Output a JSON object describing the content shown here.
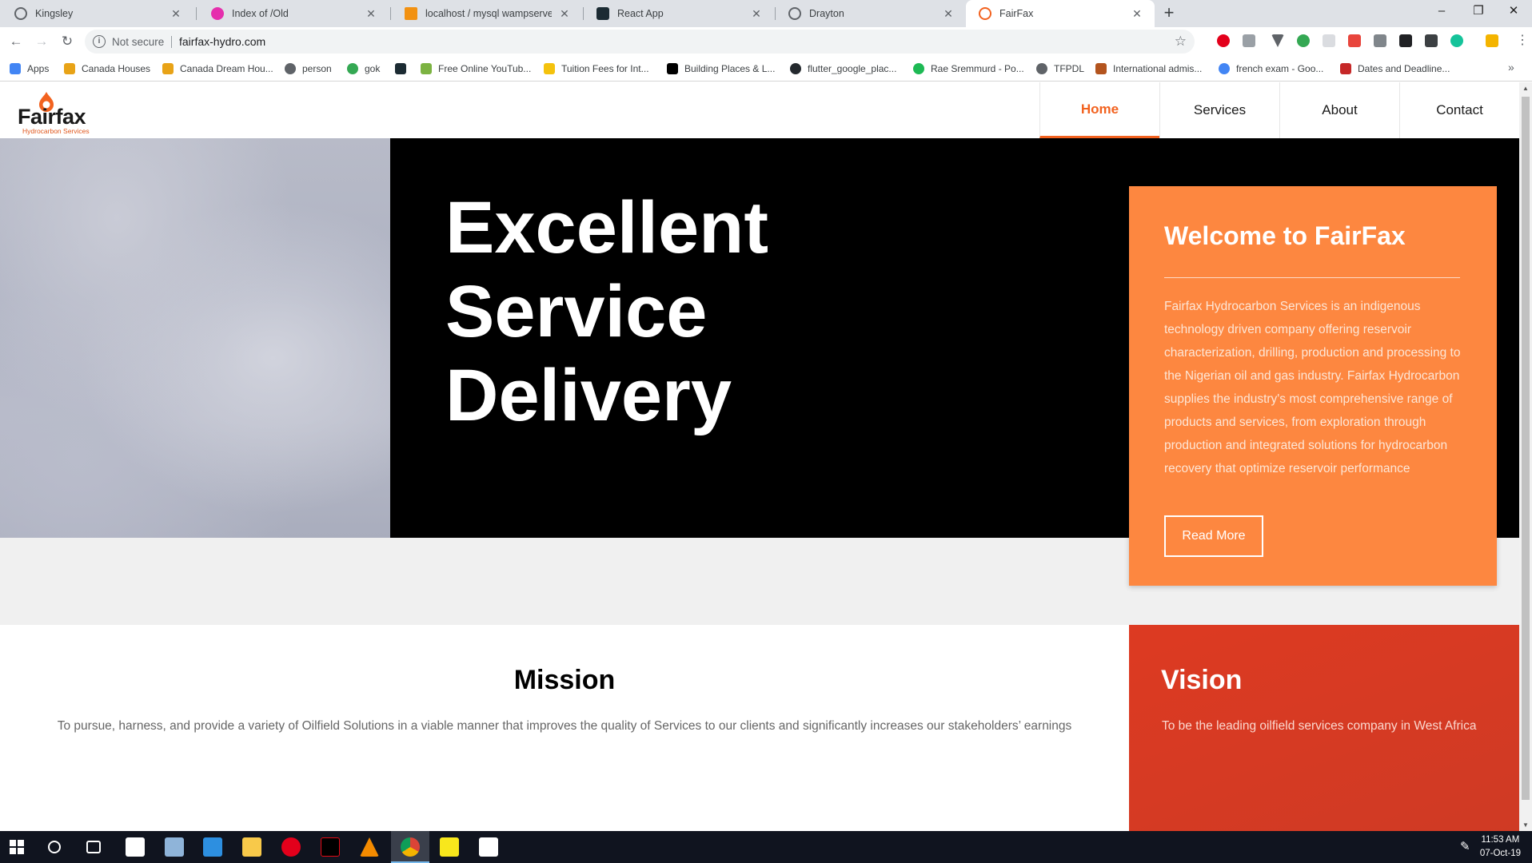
{
  "browser": {
    "tabs": [
      {
        "label": "Kingsley",
        "icon": "globe-icon",
        "color": "#5f6368"
      },
      {
        "label": "Index of /Old",
        "icon": "wamp-icon",
        "color": "#e52fad"
      },
      {
        "label": "localhost / mysql wampserver / s",
        "icon": "phpmyadmin-icon",
        "color": "#f29111"
      },
      {
        "label": "React App",
        "icon": "react-icon",
        "color": "#1c2b33"
      },
      {
        "label": "Drayton",
        "icon": "globe-icon",
        "color": "#5f6368"
      },
      {
        "label": "FairFax",
        "icon": "fairfax-icon",
        "color": "#f2621f"
      }
    ],
    "new_tab": "+",
    "window_controls": {
      "minimize": "–",
      "restore": "❐",
      "close": "✕"
    },
    "address": {
      "security": "Not secure",
      "url": "fairfax-hydro.com"
    },
    "bookmarks": [
      {
        "label": "Apps",
        "color": "#4285f4"
      },
      {
        "label": "Canada Houses",
        "color": "#e8a317"
      },
      {
        "label": "Canada Dream Hou...",
        "color": "#e8a317"
      },
      {
        "label": "person",
        "color": "#5f6368"
      },
      {
        "label": "gok",
        "color": "#34a853"
      },
      {
        "label": "",
        "color": "#1c2b33"
      },
      {
        "label": "Free Online YouTub...",
        "color": "#7cb342"
      },
      {
        "label": "Tuition Fees for Int...",
        "color": "#f4c20d"
      },
      {
        "label": "Building Places & L...",
        "color": "#000000"
      },
      {
        "label": "flutter_google_plac...",
        "color": "#24292e"
      },
      {
        "label": "Rae Sremmurd - Po...",
        "color": "#1db954"
      },
      {
        "label": "TFPDL",
        "color": "#5f6368"
      },
      {
        "label": "International admis...",
        "color": "#b3541e"
      },
      {
        "label": "french exam - Goo...",
        "color": "#4285f4"
      },
      {
        "label": "Dates and Deadline...",
        "color": "#c62828"
      }
    ]
  },
  "site": {
    "logo": {
      "name": "Fairfax",
      "tagline": "Hydrocarbon Services"
    },
    "nav": [
      "Home",
      "Services",
      "About",
      "Contact"
    ],
    "hero": {
      "line1": "Excellent",
      "line2": "Service",
      "line3": "Delivery"
    },
    "welcome": {
      "title": "Welcome to FairFax",
      "body": "Fairfax Hydrocarbon Services is an indigenous technology driven company offering reservoir characterization, drilling, production and processing to the Nigerian oil and gas industry. Fairfax Hydrocarbon supplies the industry's most comprehensive range of products and services, from exploration through production and integrated solutions for hydrocarbon recovery that optimize reservoir performance",
      "button": "Read More"
    },
    "mission": {
      "title": "Mission",
      "body": "To pursue, harness, and provide a variety of Oilfield Solutions in a viable manner that improves the quality of Services to our clients and significantly increases our stakeholders’ earnings"
    },
    "vision": {
      "title": "Vision",
      "body": "To be the leading oilfield services company in West Africa"
    }
  },
  "colors": {
    "accent": "#f2621f",
    "card": "#fd8740",
    "vision": "#d43a23"
  },
  "taskbar": {
    "time": "11:53 AM",
    "date": "07-Oct-19"
  }
}
